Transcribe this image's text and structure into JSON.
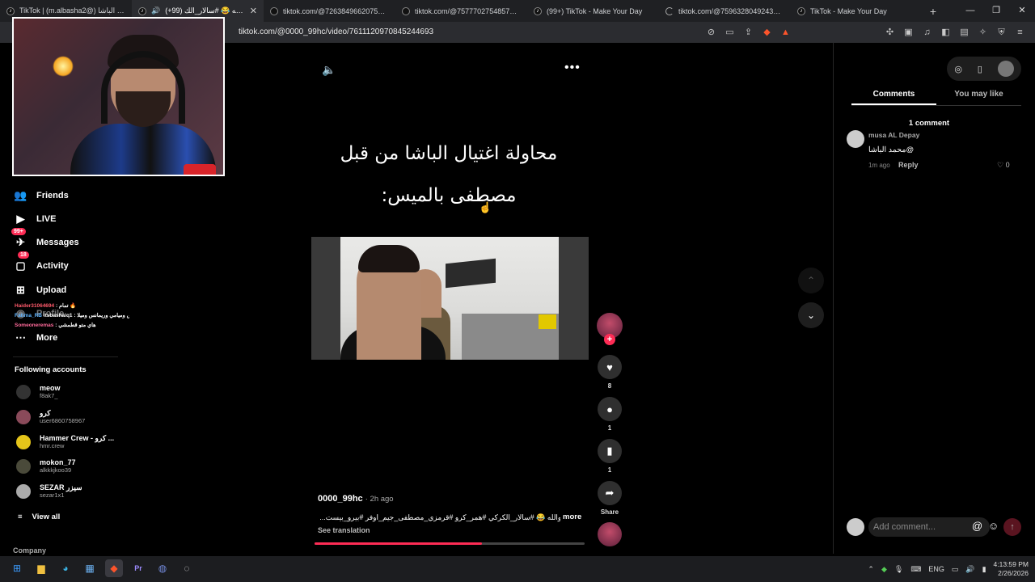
{
  "browser": {
    "tabs": [
      {
        "title": "TikTok | (m.albasha2@) محمد الباشا",
        "active": false
      },
      {
        "title": "(+99) حبيبي والله 😂 #سالار_الك",
        "active": true
      },
      {
        "title": "tiktok.com/@72638496620751595",
        "active": false
      },
      {
        "title": "tiktok.com/@757770275485748532",
        "active": false
      },
      {
        "title": "(99+) TikTok - Make Your Day",
        "active": false
      },
      {
        "title": "tiktok.com/@759632804924366952",
        "active": false
      },
      {
        "title": "TikTok - Make Your Day",
        "active": false
      }
    ],
    "url": "tiktok.com/@0000_99hc/video/7611120970845244693"
  },
  "sidebar": {
    "nav": [
      {
        "label": "Friends",
        "icon": "friends-icon",
        "badge": ""
      },
      {
        "label": "LIVE",
        "icon": "live-icon",
        "badge": ""
      },
      {
        "label": "Messages",
        "icon": "messages-icon",
        "badge": "99+"
      },
      {
        "label": "Activity",
        "icon": "activity-icon",
        "badge": "18"
      },
      {
        "label": "Upload",
        "icon": "upload-icon",
        "badge": ""
      },
      {
        "label": "Profile",
        "icon": "profile-icon",
        "badge": ""
      },
      {
        "label": "More",
        "icon": "more-icon",
        "badge": ""
      }
    ],
    "chat": [
      {
        "user": "Haider31064694",
        "text": ": تمام 🔥"
      },
      {
        "user": "Fatima_RB",
        "text": "itsbashaiq1 : اي الي ورا جبس وميامي وريمانس وميلا 🗡️"
      },
      {
        "user": "Someoneremas",
        "text": ": هاي متو قطمشي"
      }
    ],
    "following_header": "Following accounts",
    "accounts": [
      {
        "name": "meow",
        "handle": "f8ak7_"
      },
      {
        "name": "كرو",
        "handle": "user6860758967"
      },
      {
        "name": "Hammer Crew - كرو ...",
        "handle": "hmr.crew"
      },
      {
        "name": "mokon_77",
        "handle": "alkkkjkoo39"
      },
      {
        "name": "SEZAR سيزر",
        "handle": "sezar1x1"
      }
    ],
    "view_all": "View all",
    "company": "Company"
  },
  "video": {
    "caption_line1": "محاولة اغتيال الباشا من قبل",
    "caption_line2": "مصطفى بالميس:",
    "author": "0000_99hc",
    "time": "· 2h ago",
    "description": "حبيبي والله 😂 #سالار_الكركي #همر_كرو #قرمزي_مصطفى_جيم_اوفر #بيرو_بيست...",
    "more": "more",
    "see_translation": "See translation",
    "progress": 0.62
  },
  "actions": {
    "likes": "8",
    "comments": "1",
    "saves": "1",
    "share": "Share"
  },
  "panel": {
    "tabs": [
      "Comments",
      "You may like"
    ],
    "comment_count": "1 comment",
    "comments": [
      {
        "user": "musa AL Depay",
        "text": "محمد الباشا@",
        "ago": "1m ago",
        "reply": "Reply",
        "likes": "0"
      }
    ],
    "input_placeholder": "Add comment..."
  },
  "taskbar": {
    "lang": "ENG",
    "time": "4:13:59 PM",
    "date": "2/26/2026"
  }
}
